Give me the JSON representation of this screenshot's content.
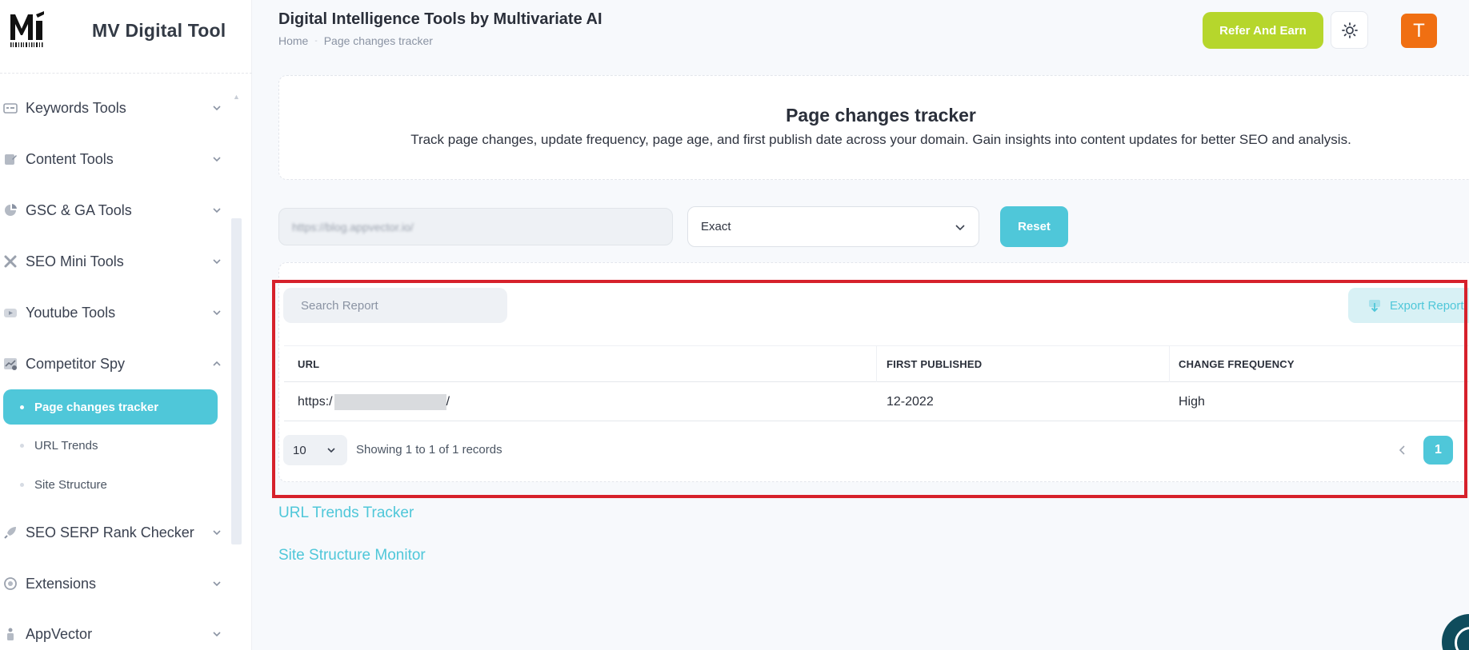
{
  "brand": {
    "name": "MV Digital Tool"
  },
  "header": {
    "title": "Digital Intelligence Tools by Multivariate AI",
    "breadcrumb": [
      "Home",
      "Page changes tracker"
    ],
    "refer_label": "Refer And Earn",
    "avatar_initial": "T"
  },
  "sidebar": {
    "items": [
      {
        "label": "Keywords Tools",
        "icon": "keyword-icon",
        "expanded": false
      },
      {
        "label": "Content Tools",
        "icon": "content-icon",
        "expanded": false
      },
      {
        "label": "GSC & GA Tools",
        "icon": "analytics-icon",
        "expanded": false
      },
      {
        "label": "SEO Mini Tools",
        "icon": "tools-icon",
        "expanded": false
      },
      {
        "label": "Youtube Tools",
        "icon": "youtube-icon",
        "expanded": false
      },
      {
        "label": "Competitor Spy",
        "icon": "chart-icon",
        "expanded": true
      },
      {
        "label": "SEO SERP Rank Checker",
        "icon": "rocket-icon",
        "expanded": false
      },
      {
        "label": "Extensions",
        "icon": "extension-icon",
        "expanded": false
      },
      {
        "label": "AppVector",
        "icon": "app-icon",
        "expanded": false
      }
    ],
    "subitems": [
      {
        "label": "Page changes tracker",
        "active": true
      },
      {
        "label": "URL Trends",
        "active": false
      },
      {
        "label": "Site Structure",
        "active": false
      }
    ]
  },
  "intro": {
    "title": "Page changes tracker",
    "description": "Track page changes, update frequency, page age, and first publish date across your domain. Gain insights into content updates for better SEO and analysis."
  },
  "form": {
    "url_value": "https://blog.appvector.io/",
    "match_value": "Exact",
    "reset_label": "Reset"
  },
  "report": {
    "search_placeholder": "Search Report",
    "export_label": "Export Report",
    "columns": [
      "URL",
      "FIRST PUBLISHED",
      "CHANGE FREQUENCY"
    ],
    "rows": [
      {
        "url": "https:/",
        "url_tail": "/",
        "first_published": "12-2022",
        "change_frequency": "High"
      }
    ],
    "page_size": "10",
    "records_text": "Showing 1 to 1 of 1 records",
    "current_page": "1"
  },
  "links": [
    "URL Trends Tracker",
    "Site Structure Monitor"
  ],
  "colors": {
    "accent": "#4fc7d9",
    "refer": "#b6d62c",
    "avatar": "#f06f12",
    "highlight": "#d6212b"
  }
}
